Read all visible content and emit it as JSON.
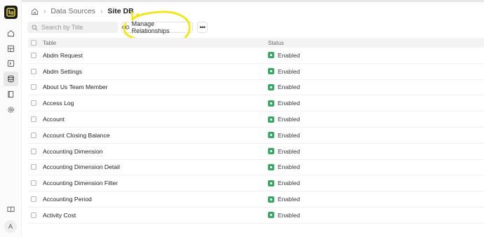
{
  "breadcrumb": {
    "part1": "Data Sources",
    "part2": "Site DB"
  },
  "toolbar": {
    "search_placeholder": "Search by Title",
    "manage_label": "Manage Relationships",
    "more_label": "•••"
  },
  "table": {
    "headers": {
      "table": "Table",
      "status": "Status"
    },
    "rows": [
      {
        "name": "Abdm Request",
        "status": "Enabled"
      },
      {
        "name": "Abdm Settings",
        "status": "Enabled"
      },
      {
        "name": "About Us Team Member",
        "status": "Enabled"
      },
      {
        "name": "Access Log",
        "status": "Enabled"
      },
      {
        "name": "Account",
        "status": "Enabled"
      },
      {
        "name": "Account Closing Balance",
        "status": "Enabled"
      },
      {
        "name": "Accounting Dimension",
        "status": "Enabled"
      },
      {
        "name": "Accounting Dimension Detail",
        "status": "Enabled"
      },
      {
        "name": "Accounting Dimension Filter",
        "status": "Enabled"
      },
      {
        "name": "Accounting Period",
        "status": "Enabled"
      },
      {
        "name": "Activity Cost",
        "status": "Enabled"
      }
    ]
  },
  "user": {
    "avatar_initial": "A"
  },
  "colors": {
    "status_enabled": "#39a866",
    "annotation": "#f5e61c"
  }
}
